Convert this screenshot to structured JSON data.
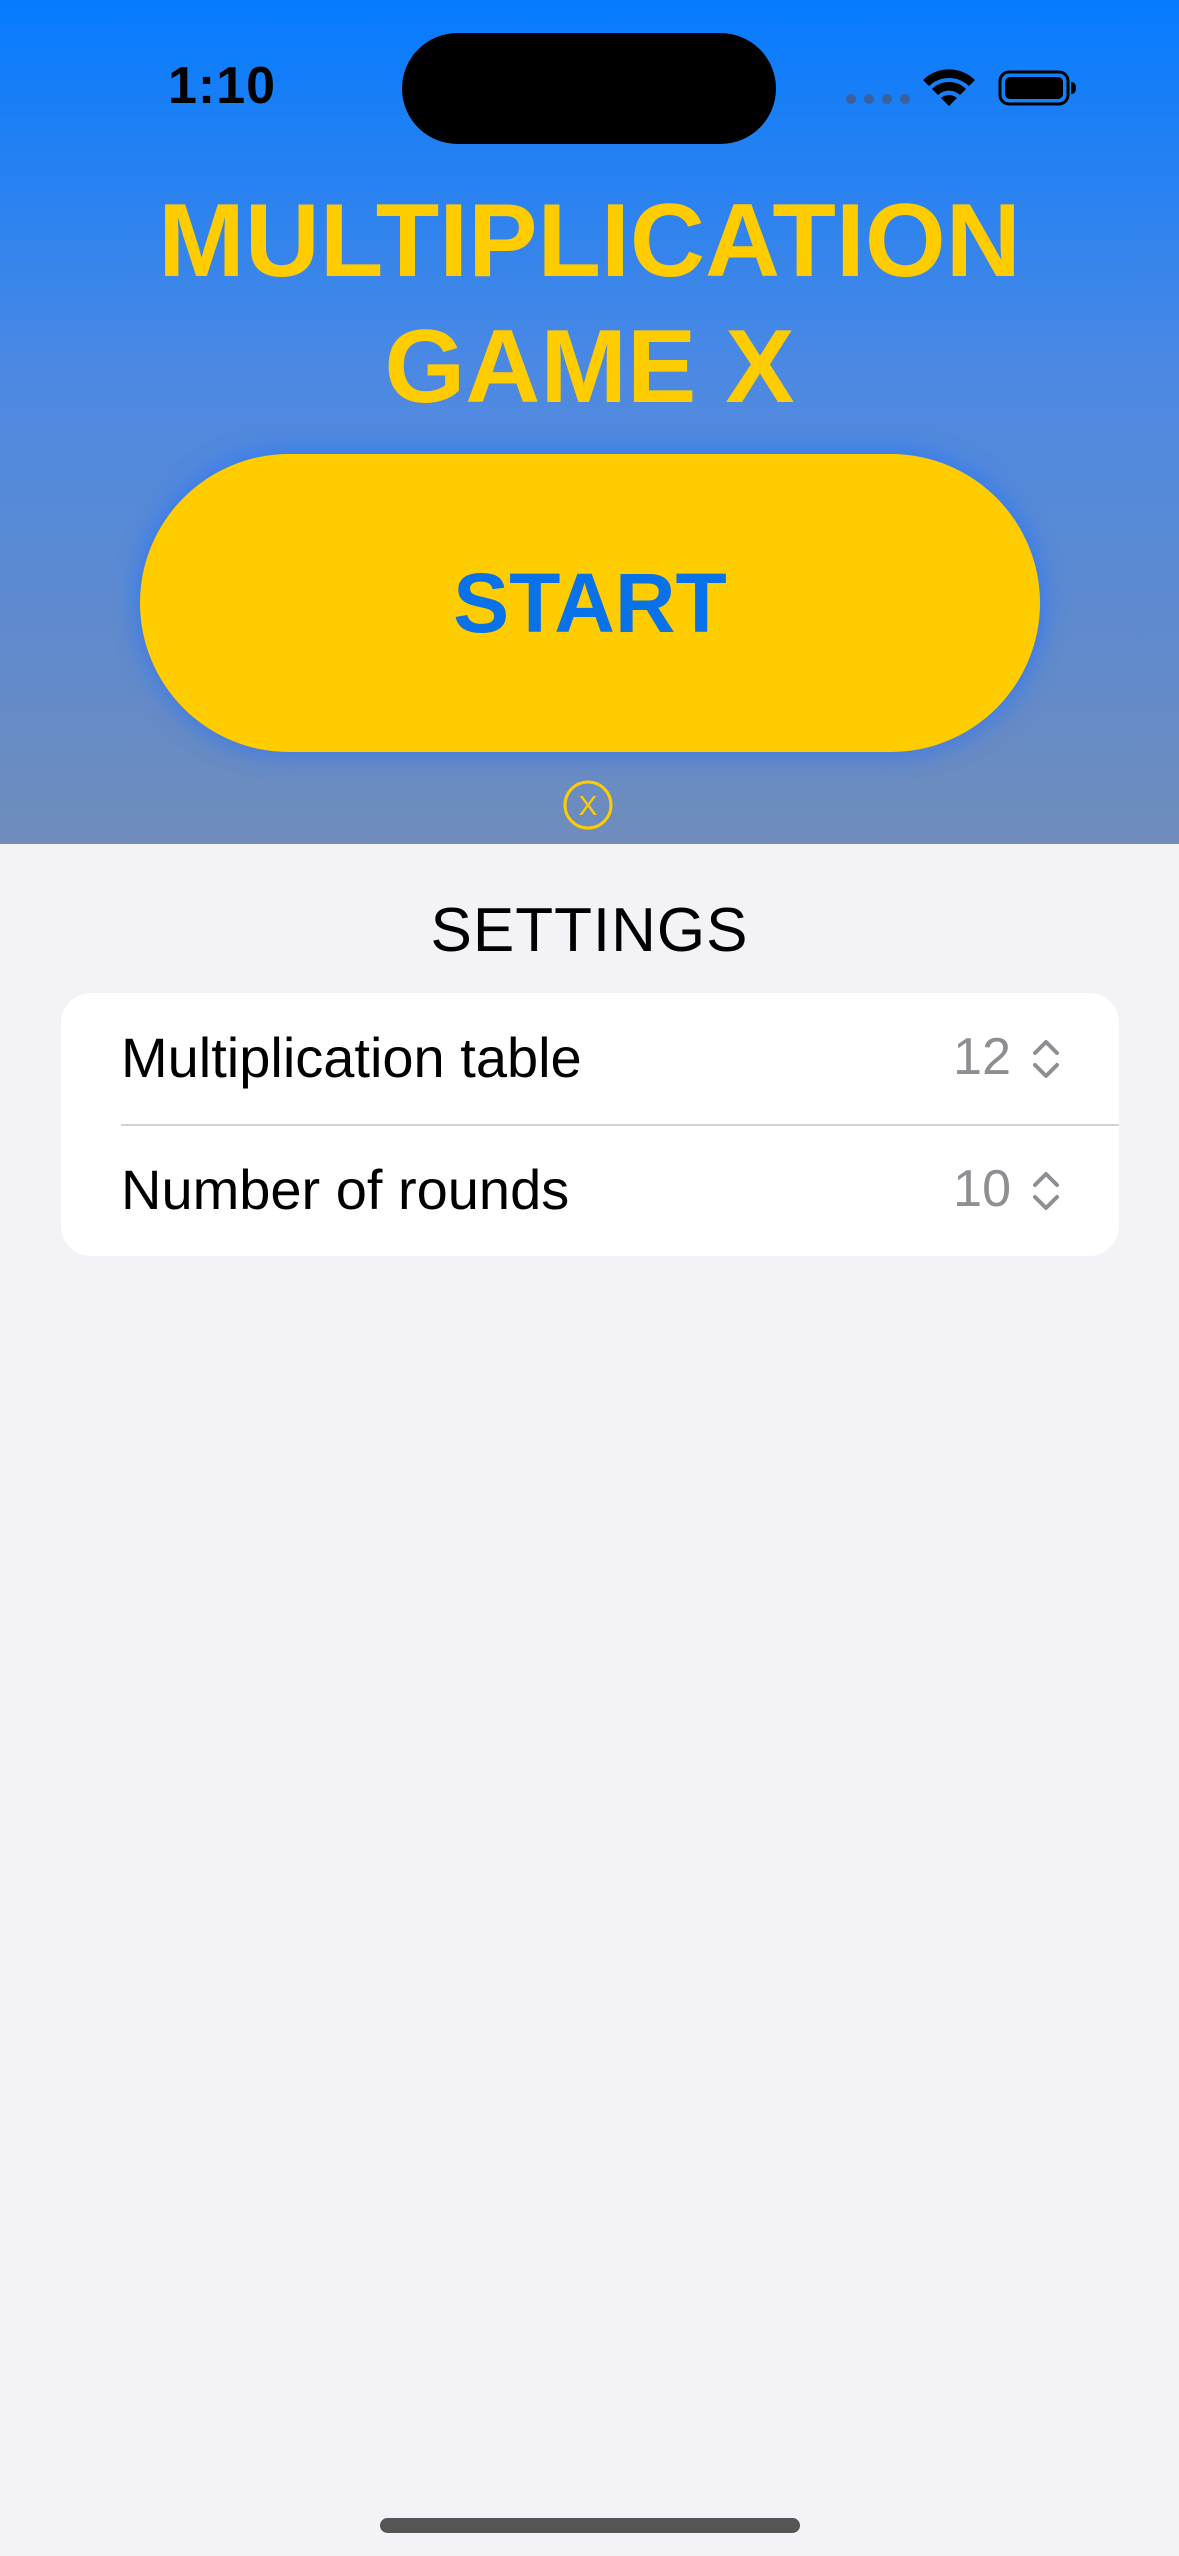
{
  "status_bar": {
    "time": "1:10"
  },
  "hero": {
    "title": "MULTIPLICATION GAME X",
    "start_label": "START",
    "close_icon_label": "X"
  },
  "settings": {
    "header": "SETTINGS",
    "rows": [
      {
        "label": "Multiplication table",
        "value": "12"
      },
      {
        "label": "Number of rounds",
        "value": "10"
      }
    ]
  },
  "colors": {
    "accent_yellow": "#ffcc00",
    "hero_top_blue": "#057bff",
    "start_text_blue": "#0a72e8",
    "background": "#f2f2f7"
  },
  "icons": [
    "wifi-icon",
    "battery-icon",
    "close-circle-icon",
    "chevron-up-down-icon"
  ]
}
